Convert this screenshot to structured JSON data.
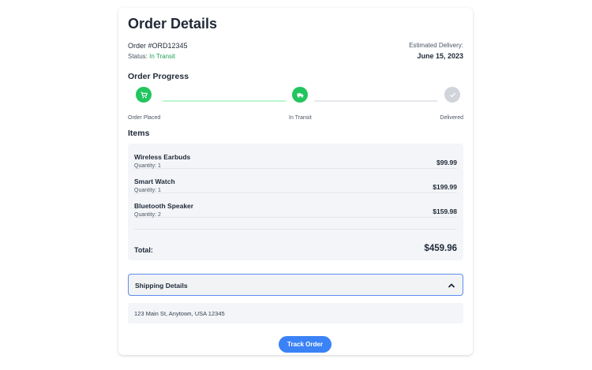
{
  "header": {
    "title": "Order Details",
    "order_id": "Order #ORD12345",
    "status_label": "Status: ",
    "status_value": "In Transit",
    "estimated_label": "Estimated Delivery:",
    "estimated_date": "June 15, 2023"
  },
  "progress": {
    "title": "Order Progress",
    "steps": [
      {
        "label": "Order Placed",
        "icon": "cart-icon",
        "state": "done"
      },
      {
        "label": "In Transit",
        "icon": "truck-icon",
        "state": "done"
      },
      {
        "label": "Delivered",
        "icon": "check-icon",
        "state": "pending"
      }
    ]
  },
  "items": {
    "title": "Items",
    "list": [
      {
        "name": "Wireless Earbuds",
        "quantity": "Quantity: 1",
        "price": "$99.99"
      },
      {
        "name": "Smart Watch",
        "quantity": "Quantity: 1",
        "price": "$199.99"
      },
      {
        "name": "Bluetooth Speaker",
        "quantity": "Quantity: 2",
        "price": "$159.98"
      }
    ],
    "total_label": "Total:",
    "total_value": "$459.96"
  },
  "shipping": {
    "label": "Shipping Details",
    "address": "123 Main St, Anytown, USA 12345",
    "expanded": true
  },
  "actions": {
    "track_label": "Track Order"
  },
  "colors": {
    "success": "#22c55e",
    "accent": "#3b82f6",
    "pending": "#d1d5db"
  }
}
